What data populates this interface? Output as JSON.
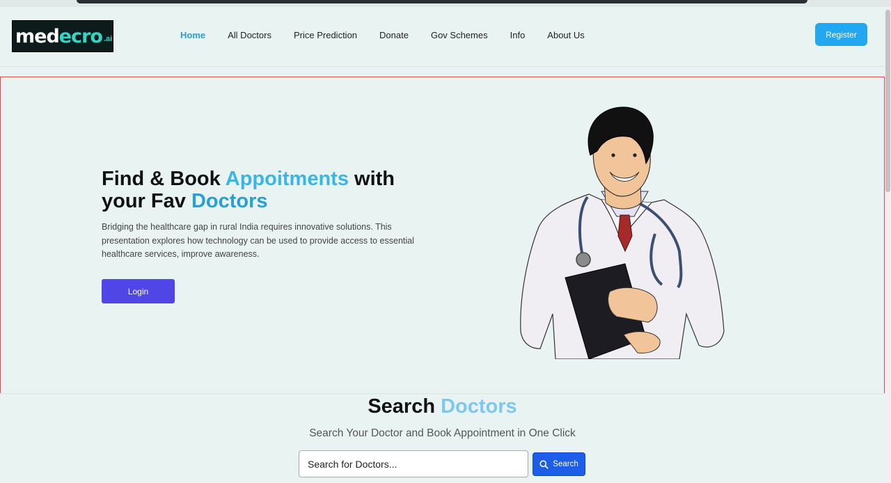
{
  "nav": {
    "logo_main": "med",
    "logo_accent": "ecro",
    "logo_suffix": ".ai",
    "links": [
      "Home",
      "All Doctors",
      "Price Prediction",
      "Donate",
      "Gov Schemes",
      "Info",
      "About Us"
    ],
    "active": "Home",
    "register_label": "Register"
  },
  "hero": {
    "title_part1": "Find & Book ",
    "title_highlight1": "Appoitments",
    "title_part2": " with your Fav ",
    "title_highlight2": "Doctors",
    "description": "Bridging the healthcare gap in rural India requires innovative solutions. This presentation explores how technology can be used to provide access to essential healthcare services, improve awareness.",
    "login_label": "Login",
    "illustration": "doctor-illustration"
  },
  "search": {
    "title_part1": "Search ",
    "title_highlight": "Doctors",
    "subtitle": "Search Your Doctor and Book Appointment in One Click",
    "input_value": "",
    "input_placeholder": "Search for Doctors...",
    "button_label": "Search",
    "button_icon": "search-icon"
  },
  "colors": {
    "background": "#e9f3f2",
    "accent_blue": "#2a9fd6",
    "register_button": "#23a7f0",
    "login_button": "#4f46e5",
    "search_button": "#1d5ee8"
  }
}
